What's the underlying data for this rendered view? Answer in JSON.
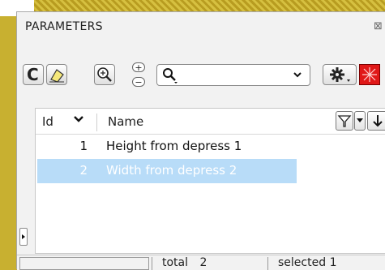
{
  "panel": {
    "title": "PARAMETERS",
    "close_glyph": "⊠"
  },
  "toolbar": {
    "refresh_icon": "refresh-icon",
    "plus": "+",
    "minus": "−",
    "search_value": "",
    "search_placeholder": ""
  },
  "list": {
    "columns": {
      "id": "Id",
      "name": "Name"
    },
    "rows": [
      {
        "id": "1",
        "name": "Height from depress 1",
        "selected": false
      },
      {
        "id": "2",
        "name": "Width from depress 2",
        "selected": true
      }
    ]
  },
  "status": {
    "total_label": "total",
    "total_value": "2",
    "selected_label": "selected",
    "selected_value": "1"
  },
  "colors": {
    "selection": "#b8dcf8",
    "alert_button": "#e01818"
  }
}
